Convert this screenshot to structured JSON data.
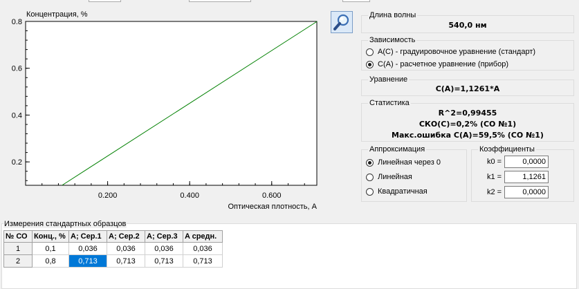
{
  "chart": {
    "ylabel": "Концентрация, %",
    "xlabel": "Оптическая плотность, A"
  },
  "chart_data": {
    "type": "line",
    "ylabel": "Концентрация, %",
    "xlabel": "Оптическая плотность, A",
    "xlim": [
      0.0,
      0.71
    ],
    "ylim": [
      0.1,
      0.8
    ],
    "x_ticks": [
      0.2,
      0.4,
      0.6
    ],
    "x_tick_labels": [
      "0.200",
      "0.400",
      "0.600"
    ],
    "y_ticks": [
      0.2,
      0.4,
      0.6,
      0.8
    ],
    "y_tick_labels": [
      "0.2",
      "0.4",
      "0.6",
      "0.8"
    ],
    "grid": false,
    "series": [
      {
        "x": [
          0.0888,
          0.7105
        ],
        "y": [
          0.1,
          0.8
        ],
        "color": "#008000"
      }
    ]
  },
  "icons": {
    "zoom": "magnifier-icon"
  },
  "wavelength": {
    "title": "Длина волны",
    "value": "540,0 нм"
  },
  "dependency": {
    "title": "Зависимость",
    "options": [
      {
        "label": "A(C) - градуировочное уравнение (стандарт)",
        "checked": false
      },
      {
        "label": "C(A) - расчетное уравнение (прибор)",
        "checked": true
      }
    ]
  },
  "equation": {
    "title": "Уравнение",
    "value": "C(A)=1,1261*A"
  },
  "statistics": {
    "title": "Статистика",
    "lines": [
      "R^2=0,99455",
      "СКО(C)=0,2% (СО №1)",
      "Макс.ошибка C(A)=59,5% (СО №1)"
    ]
  },
  "approximation": {
    "title": "Аппроксимация",
    "options": [
      {
        "label": "Линейная через 0",
        "checked": true
      },
      {
        "label": "Линейная",
        "checked": false
      },
      {
        "label": "Квадратичная",
        "checked": false
      }
    ]
  },
  "coefficients": {
    "title": "Коэффициенты",
    "items": [
      {
        "label": "k0 =",
        "value": "0,0000"
      },
      {
        "label": "k1 =",
        "value": "1,1261"
      },
      {
        "label": "k2 =",
        "value": "0,0000"
      }
    ]
  },
  "measurements": {
    "title": "Измерения стандартных образцов",
    "columns": [
      "№ СО",
      "Конц., %",
      "A; Сер.1",
      "A; Сер.2",
      "A; Сер.3",
      "A средн."
    ],
    "rows": [
      [
        "1",
        "0,1",
        "0,036",
        "0,036",
        "0,036",
        "0,036"
      ],
      [
        "2",
        "0,8",
        "0,713",
        "0,713",
        "0,713",
        "0,713"
      ]
    ],
    "selected_cell": [
      1,
      2
    ]
  },
  "colors": {
    "line": "#008000",
    "selection": "#0078d7"
  }
}
